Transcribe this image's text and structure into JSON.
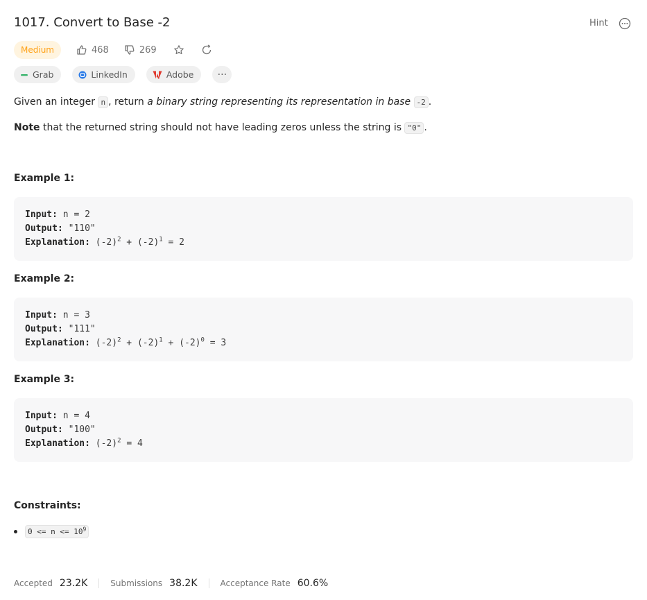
{
  "problem": {
    "title": "1017. Convert to Base -2",
    "hint_label": "Hint",
    "difficulty": "Medium",
    "likes": "468",
    "dislikes": "269",
    "tags": [
      {
        "label": "Grab",
        "icon": "grab-icon"
      },
      {
        "label": "LinkedIn",
        "icon": "linkedin-icon"
      },
      {
        "label": "Adobe",
        "icon": "adobe-icon"
      }
    ],
    "more_tags": "···"
  },
  "description": {
    "p1_a": "Given an integer ",
    "p1_code1": "n",
    "p1_b": ", return ",
    "p1_em": "a binary string representing its representation in base",
    "p1_code2": "-2",
    "p1_c": ".",
    "p2_note": "Note",
    "p2_a": " that the returned string should not have leading zeros unless the string is ",
    "p2_code": "\"0\"",
    "p2_b": "."
  },
  "examples": [
    {
      "heading": "Example 1:",
      "input_label": "Input:",
      "input": "n = 2",
      "output_label": "Output:",
      "output": "\"110\"",
      "explanation_label": "Explanation:",
      "explanation_terms": [
        {
          "base": "(-2)",
          "exp": "2"
        },
        {
          "base": "(-2)",
          "exp": "1"
        }
      ],
      "explanation_result": "= 2"
    },
    {
      "heading": "Example 2:",
      "input_label": "Input:",
      "input": "n = 3",
      "output_label": "Output:",
      "output": "\"111\"",
      "explanation_label": "Explanation:",
      "explanation_terms": [
        {
          "base": "(-2)",
          "exp": "2"
        },
        {
          "base": "(-2)",
          "exp": "1"
        },
        {
          "base": "(-2)",
          "exp": "0"
        }
      ],
      "explanation_result": "= 3"
    },
    {
      "heading": "Example 3:",
      "input_label": "Input:",
      "input": "n = 4",
      "output_label": "Output:",
      "output": "\"100\"",
      "explanation_label": "Explanation:",
      "explanation_terms": [
        {
          "base": "(-2)",
          "exp": "2"
        }
      ],
      "explanation_result": "= 4"
    }
  ],
  "constraints": {
    "heading": "Constraints:",
    "item_base": "0 <= n <= 10",
    "item_exp": "9"
  },
  "stats": {
    "accepted_label": "Accepted",
    "accepted": "23.2K",
    "submissions_label": "Submissions",
    "submissions": "38.2K",
    "rate_label": "Acceptance Rate",
    "rate": "60.6%"
  },
  "colors": {
    "medium_text": "#ffa116",
    "medium_bg": "#fff4df",
    "code_bg": "#f7f7f8"
  }
}
